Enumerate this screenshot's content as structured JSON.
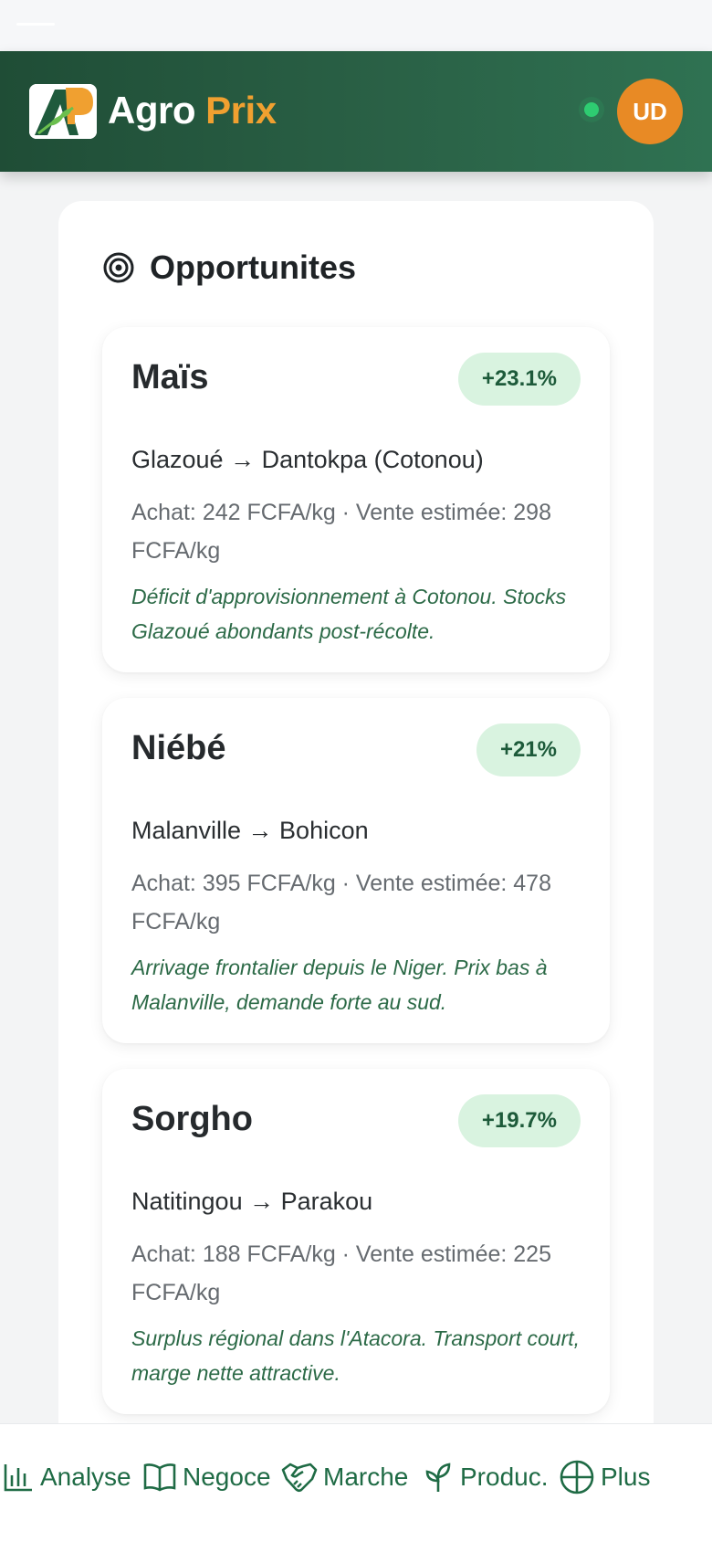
{
  "header": {
    "brand_first": "Agro",
    "brand_second": "Prix",
    "avatar_initials": "UD",
    "status": "online",
    "colors": {
      "header_start": "#1f4d36",
      "header_end": "#2f7252",
      "accent": "#f0a030",
      "avatar": "#e88a25",
      "online": "#2ecc71"
    }
  },
  "section": {
    "icon": "target-icon",
    "title": "Opportunites"
  },
  "cards": [
    {
      "name": "Maïs",
      "badge": "+23.1%",
      "route": "Glazoué → Dantokpa (Cotonou)",
      "prices": "Achat: 242 FCFA/kg · Vente estimée: 298 FCFA/kg",
      "note": "Déficit d'approvisionnement à Cotonou. Stocks Glazoué abondants post-récolte."
    },
    {
      "name": "Niébé",
      "badge": "+21%",
      "route": "Malanville → Bohicon",
      "prices": "Achat: 395 FCFA/kg · Vente estimée: 478 FCFA/kg",
      "note": "Arrivage frontalier depuis le Niger. Prix bas à Malanville, demande forte au sud."
    },
    {
      "name": "Sorgho",
      "badge": "+19.7%",
      "route": "Natitingou → Parakou",
      "prices": "Achat: 188 FCFA/kg · Vente estimée: 225 FCFA/kg",
      "note": "Surplus régional dans l'Atacora. Transport court, marge nette attractive."
    }
  ],
  "nav": {
    "items": [
      {
        "label": "Analyse",
        "icon": "bar-chart-icon"
      },
      {
        "label": "Negoce",
        "icon": "book-icon"
      },
      {
        "label": "Marche",
        "icon": "handshake-icon"
      },
      {
        "label": "Produc.",
        "icon": "sprout-icon"
      },
      {
        "label": "Plus",
        "icon": "globe-icon"
      }
    ]
  }
}
